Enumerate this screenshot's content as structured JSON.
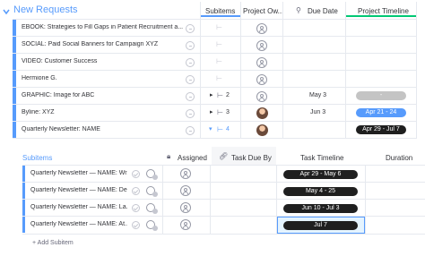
{
  "group": {
    "title": "New Requests",
    "color": "#579bfc"
  },
  "columns": {
    "subitems": "Subitems",
    "project_owner": "Project Ow...",
    "due_date": "Due Date",
    "project_timeline": "Project Timeline"
  },
  "rows": [
    {
      "name": "EBOOK: Strategies to Fill Gaps in Patient Recruitment a...",
      "subitems": "",
      "due": "",
      "timeline": ""
    },
    {
      "name": "SOCIAL: Paid Social Banners for Campaign XYZ",
      "subitems": "",
      "due": "",
      "timeline": ""
    },
    {
      "name": "VIDEO: Customer Success",
      "subitems": "",
      "due": "",
      "timeline": ""
    },
    {
      "name": "Hermione G.",
      "subitems": "",
      "due": "",
      "timeline": ""
    },
    {
      "name": "GRAPHIC: Image for ABC",
      "subitems": "2",
      "due": "May 3",
      "timeline": "-"
    },
    {
      "name": "Byline: XYZ",
      "subitems": "3",
      "due": "Jun 3",
      "timeline": "Apr 21 - 24"
    },
    {
      "name": "Quarterly Newsletter: NAME",
      "subitems": "4",
      "due": "",
      "timeline": "Apr 29 - Jul 7"
    }
  ],
  "subitems_table": {
    "header": {
      "subitems": "Subitems",
      "assigned": "Assigned",
      "task_due_by": "Task Due By",
      "task_timeline": "Task Timeline",
      "duration": "Duration"
    },
    "rows": [
      {
        "name": "Quarterly Newsletter — NAME: Wr...",
        "timeline": "Apr 29 - May 6"
      },
      {
        "name": "Quarterly Newsletter — NAME: Design ...",
        "timeline": "May 4 - 25"
      },
      {
        "name": "Quarterly Newsletter — NAME: La...",
        "timeline": "Jun 10 - Jul 3"
      },
      {
        "name": "Quarterly Newsletter — NAME: At...",
        "timeline": "Jul 7"
      }
    ],
    "add_label": "+ Add Subitem"
  }
}
